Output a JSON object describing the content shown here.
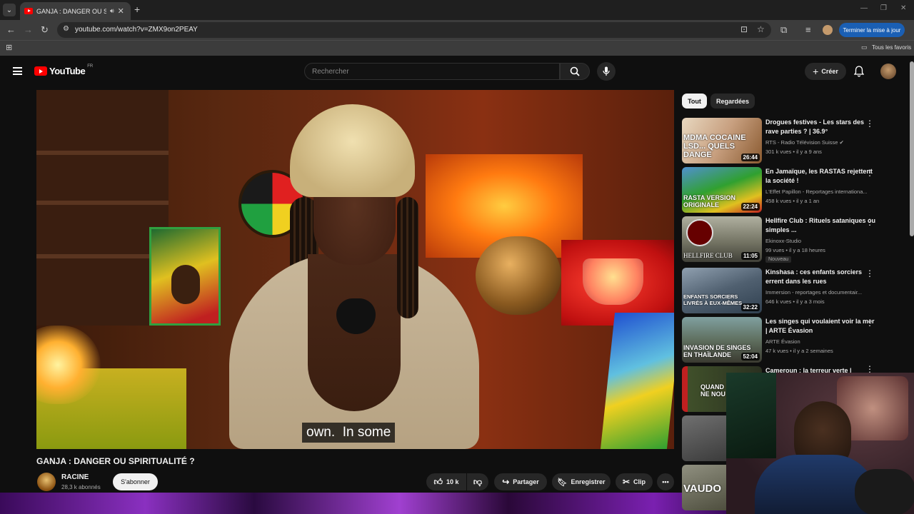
{
  "browser": {
    "tab_title": "GANJA : DANGER OU SPIRI",
    "url": "youtube.com/watch?v=ZMX9on2PEAY",
    "update_label": "Terminer la mise à jour",
    "bookmarks_label": "Tous les favoris"
  },
  "header": {
    "logo_text": "YouTube",
    "logo_country": "FR",
    "search_placeholder": "Rechercher",
    "create_label": "Créer"
  },
  "video": {
    "caption": "own.  In some",
    "title": "GANJA : DANGER OU SPIRITUALITÉ ?",
    "channel": "RACINE",
    "subscribers": "28,3 k abonnés",
    "subscribe_label": "S'abonner",
    "likes": "10 k",
    "share_label": "Partager",
    "save_label": "Enregistrer",
    "clip_label": "Clip"
  },
  "sidebar": {
    "chips": [
      "Tout",
      "Regardées"
    ],
    "items": [
      {
        "title": "Drogues festives - Les stars des rave parties ? | 36.9°",
        "channel": "RTS - Radio Télévision Suisse",
        "meta": "301 k vues • il y a 9 ans",
        "duration": "26:44",
        "thumb_text": "MDMA COCAINE LSD... QUELS DANGE",
        "verified": true
      },
      {
        "title": "En Jamaïque, les RASTAS rejettent la société !",
        "channel": "L'Effet Papillon - Reportages internationa...",
        "meta": "458 k vues • il y a 1 an",
        "duration": "22:24",
        "thumb_text": "RASTA VERSION ORIGINALE"
      },
      {
        "title": "Hellfire Club : Rituels sataniques ou simples ...",
        "channel": "Ekinoxx-Studio",
        "meta": "99 vues • il y a 18 heures",
        "duration": "11:05",
        "thumb_text": "HELLFIRE CLUB",
        "badge": "Nouveau"
      },
      {
        "title": "Kinshasa : ces enfants sorciers errent dans les rues",
        "channel": "Immersion - reportages et documentair...",
        "meta": "646 k vues • il y a 3 mois",
        "duration": "32:22",
        "thumb_text": "ENFANTS SORCIERS LIVRÉS À EUX-MÊMES"
      },
      {
        "title": "Les singes qui voulaient voir la mer | ARTE Évasion",
        "channel": "ARTE Évasion",
        "meta": "47 k vues • il y a 2 semaines",
        "duration": "52:04",
        "thumb_text": "INVASION DE SINGES EN THAÏLANDE"
      },
      {
        "title": "Cameroun : la terreur verte |",
        "thumb_text": "QUAND NE NOU"
      },
      {
        "thumb_text": ""
      },
      {
        "thumb_text": "VAUDO"
      }
    ]
  }
}
